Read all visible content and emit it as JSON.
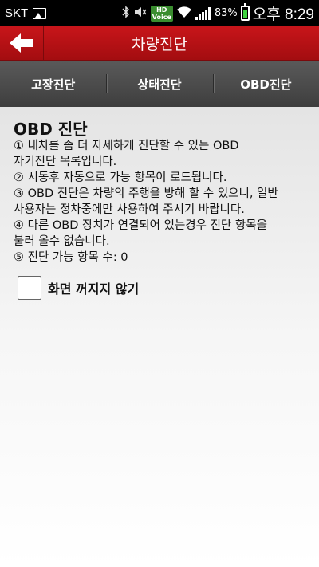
{
  "status_bar": {
    "carrier": "SKT",
    "battery": "83%",
    "battery_level": 0.83,
    "time": "오후 8:29",
    "hd_voice_top": "HD",
    "hd_voice_bottom": "Voice",
    "icons": [
      "image-icon",
      "bluetooth-icon",
      "mute-icon",
      "hd-voice-icon",
      "wifi-icon",
      "signal-icon",
      "battery-icon"
    ]
  },
  "header": {
    "title": "차량진단",
    "accent_color": "#b51014"
  },
  "tabs": [
    {
      "label": "고장진단"
    },
    {
      "label": "상태진단"
    },
    {
      "label": "OBD진단"
    }
  ],
  "main": {
    "heading": "OBD 진단",
    "lines": [
      "① 내차를 좀 더 자세하게 진단할 수 있는 OBD",
      "자기진단 목록입니다.",
      "② 시동후 자동으로 가능 항목이 로드됩니다.",
      "③ OBD 진단은 차량의 주행을 방해 할 수 있으니, 일반",
      "사용자는 정차중에만 사용하여 주시기 바랍니다.",
      "④ 다른 OBD 장치가 연결되어 있는경우 진단 항목을",
      "불러 올수 없습니다.",
      "⑤ 진단 가능 항목 수: 0"
    ],
    "keep_screen_on_label": "화면 꺼지지 않기"
  }
}
